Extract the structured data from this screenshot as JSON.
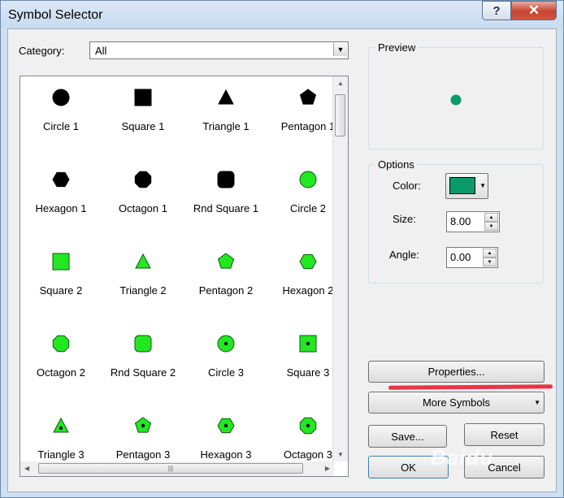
{
  "window": {
    "title": "Symbol Selector",
    "help_label": "?",
    "close_label": "✕"
  },
  "category": {
    "label": "Category:",
    "value": "All"
  },
  "symbols": [
    {
      "name": "Circle 1",
      "shape": "circle",
      "fill": "#000000",
      "dot": false
    },
    {
      "name": "Square 1",
      "shape": "square",
      "fill": "#000000",
      "dot": false
    },
    {
      "name": "Triangle 1",
      "shape": "triangle",
      "fill": "#000000",
      "dot": false
    },
    {
      "name": "Pentagon 1",
      "shape": "pentagon",
      "fill": "#000000",
      "dot": false
    },
    {
      "name": "Hexagon 1",
      "shape": "hexagon",
      "fill": "#000000",
      "dot": false
    },
    {
      "name": "Octagon 1",
      "shape": "octagon",
      "fill": "#000000",
      "dot": false
    },
    {
      "name": "Rnd Square 1",
      "shape": "rndsquare",
      "fill": "#000000",
      "dot": false
    },
    {
      "name": "Circle 2",
      "shape": "circle",
      "fill": "#22e822",
      "dot": false
    },
    {
      "name": "Square 2",
      "shape": "square",
      "fill": "#22e822",
      "dot": false
    },
    {
      "name": "Triangle 2",
      "shape": "triangle",
      "fill": "#22e822",
      "dot": false
    },
    {
      "name": "Pentagon 2",
      "shape": "pentagon",
      "fill": "#22e822",
      "dot": false
    },
    {
      "name": "Hexagon 2",
      "shape": "hexagon",
      "fill": "#22e822",
      "dot": false
    },
    {
      "name": "Octagon 2",
      "shape": "octagon",
      "fill": "#22e822",
      "dot": false
    },
    {
      "name": "Rnd Square 2",
      "shape": "rndsquare",
      "fill": "#22e822",
      "dot": false
    },
    {
      "name": "Circle 3",
      "shape": "circle",
      "fill": "#22e822",
      "dot": true
    },
    {
      "name": "Square 3",
      "shape": "square",
      "fill": "#22e822",
      "dot": true
    },
    {
      "name": "Triangle 3",
      "shape": "triangle",
      "fill": "#22e822",
      "dot": true
    },
    {
      "name": "Pentagon 3",
      "shape": "pentagon",
      "fill": "#22e822",
      "dot": true
    },
    {
      "name": "Hexagon 3",
      "shape": "hexagon",
      "fill": "#22e822",
      "dot": true
    },
    {
      "name": "Octagon 3",
      "shape": "octagon",
      "fill": "#22e822",
      "dot": true
    }
  ],
  "preview": {
    "label": "Preview",
    "symbol_color": "#0c9a6a"
  },
  "options": {
    "label": "Options",
    "color_label": "Color:",
    "color_value": "#0c9a6a",
    "size_label": "Size:",
    "size_value": "8.00",
    "angle_label": "Angle:",
    "angle_value": "0.00"
  },
  "buttons": {
    "properties": "Properties...",
    "more_symbols": "More Symbols",
    "save": "Save...",
    "reset": "Reset",
    "ok": "OK",
    "cancel": "Cancel"
  },
  "watermark": "Baidu"
}
